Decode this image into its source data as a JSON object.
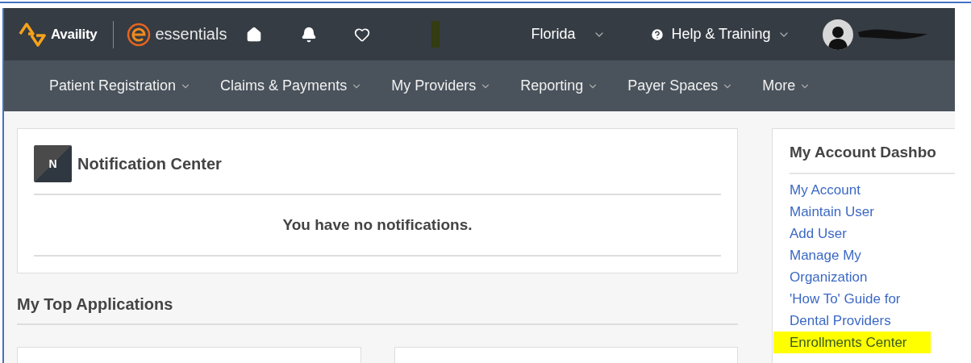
{
  "header": {
    "brand": "Availity",
    "product": "essentials",
    "region": "Florida",
    "help": "Help & Training"
  },
  "nav": [
    {
      "label": "Patient Registration"
    },
    {
      "label": "Claims & Payments"
    },
    {
      "label": "My Providers"
    },
    {
      "label": "Reporting"
    },
    {
      "label": "Payer Spaces"
    },
    {
      "label": "More"
    }
  ],
  "notification_center": {
    "badge": "N",
    "title": "Notification Center",
    "message": "You have no notifications."
  },
  "top_applications": {
    "title": "My Top Applications"
  },
  "account_dashboard": {
    "title": "My Account Dashbo",
    "links": [
      {
        "label": "My Account",
        "highlighted": false
      },
      {
        "label": "Maintain User",
        "highlighted": false
      },
      {
        "label": "Add User",
        "highlighted": false
      },
      {
        "label": "Manage My Organization",
        "highlighted": false
      },
      {
        "label": "'How To' Guide for Dental Providers",
        "highlighted": false
      },
      {
        "label": "Enrollments Center",
        "highlighted": true
      }
    ]
  }
}
